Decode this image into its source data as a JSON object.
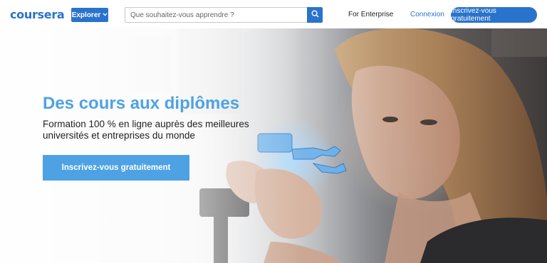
{
  "header": {
    "logo_text": "coursera",
    "explore_label": "Explorer",
    "explore_icon": "chevron-down-icon",
    "search": {
      "placeholder": "Que souhaitez-vous apprendre ?",
      "value": "",
      "icon": "search-icon"
    },
    "enterprise_link": "For Enterprise",
    "login_link": "Connexion",
    "signup_button": "Inscrivez-vous gratuitement"
  },
  "hero": {
    "title": "Des cours aux diplômes",
    "subtitle": "Formation 100 % en ligne auprès des meilleures universités et entreprises du monde",
    "cta_button": "Inscrivez-vous gratuitement"
  },
  "colors": {
    "brand_blue": "#2a73cc",
    "hero_accent": "#4ea2e4",
    "text_dark": "#1f1f1f"
  }
}
